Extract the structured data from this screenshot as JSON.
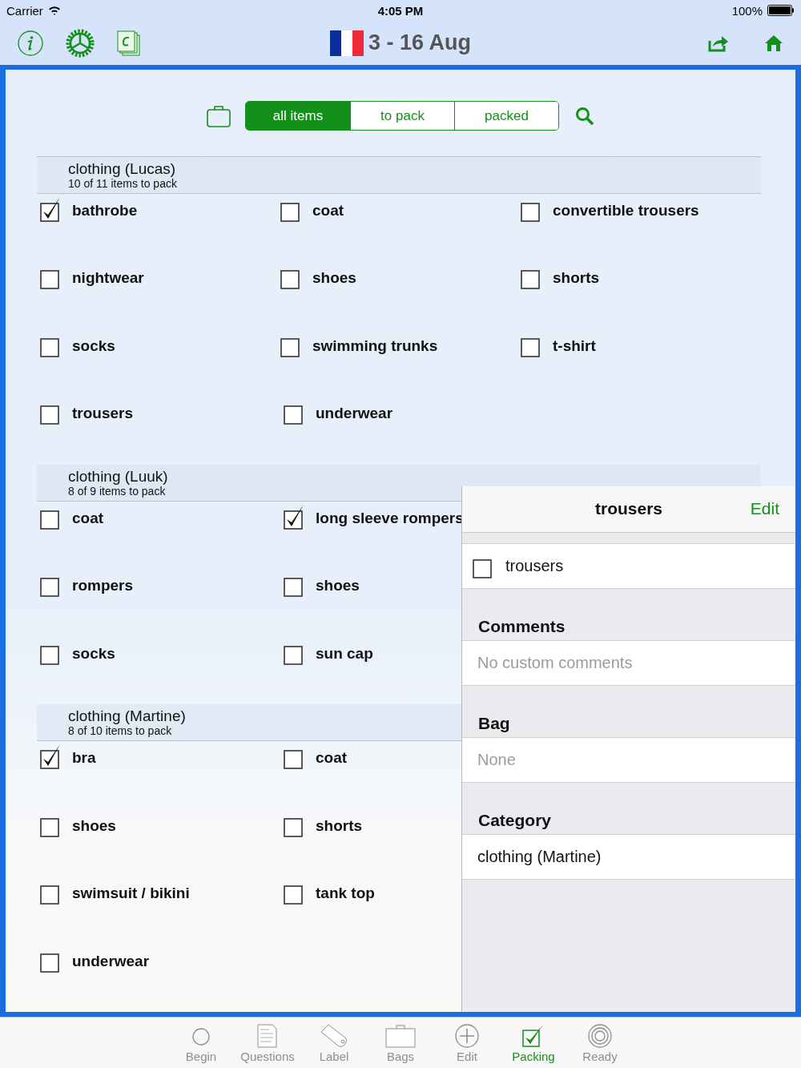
{
  "status_bar": {
    "carrier": "Carrier",
    "time": "4:05 PM",
    "battery": "100%"
  },
  "nav": {
    "title": "3 - 16 Aug"
  },
  "filter": {
    "segments": [
      {
        "label": "all items",
        "selected": true
      },
      {
        "label": "to pack",
        "selected": false
      },
      {
        "label": "packed",
        "selected": false
      }
    ]
  },
  "sections": [
    {
      "title": "clothing (Lucas)",
      "subtitle": "10 of 11 items to pack",
      "rows": [
        [
          {
            "label": "bathrobe",
            "checked": true
          },
          {
            "label": "coat",
            "checked": false
          },
          {
            "label": "convertible trousers",
            "checked": false
          }
        ],
        [
          {
            "label": "nightwear",
            "checked": false
          },
          {
            "label": "shoes",
            "checked": false
          },
          {
            "label": "shorts",
            "checked": false
          }
        ],
        [
          {
            "label": "socks",
            "checked": false
          },
          {
            "label": "swimming trunks",
            "checked": false
          },
          {
            "label": "t-shirt",
            "checked": false
          }
        ],
        [
          {
            "label": "trousers",
            "checked": false
          },
          {
            "label": "underwear",
            "checked": false
          }
        ]
      ]
    },
    {
      "title": "clothing (Luuk)",
      "subtitle": "8 of 9 items to pack",
      "rows": [
        [
          {
            "label": "coat",
            "checked": false
          },
          {
            "label": "long sleeve rompers",
            "checked": true
          }
        ],
        [
          {
            "label": "rompers",
            "checked": false
          },
          {
            "label": "shoes",
            "checked": false
          }
        ],
        [
          {
            "label": "socks",
            "checked": false
          },
          {
            "label": "sun cap",
            "checked": false
          }
        ]
      ]
    },
    {
      "title": "clothing (Martine)",
      "subtitle": "8 of 10 items to pack",
      "rows": [
        [
          {
            "label": "bra",
            "checked": true
          },
          {
            "label": "coat",
            "checked": false
          }
        ],
        [
          {
            "label": "shoes",
            "checked": false
          },
          {
            "label": "shorts",
            "checked": false
          }
        ],
        [
          {
            "label": "swimsuit / bikini",
            "checked": false
          },
          {
            "label": "tank top",
            "checked": false
          }
        ],
        [
          {
            "label": "underwear",
            "checked": false
          }
        ]
      ]
    }
  ],
  "detail": {
    "title": "trousers",
    "edit": "Edit",
    "item": {
      "label": "trousers",
      "checked": false
    },
    "groups": [
      {
        "heading": "Comments",
        "value": "No custom comments",
        "kind": "placeholder"
      },
      {
        "heading": "Bag",
        "value": "None",
        "kind": "placeholder"
      },
      {
        "heading": "Category",
        "value": "clothing (Martine)",
        "kind": "value"
      }
    ]
  },
  "tab_bar": [
    {
      "label": "Begin",
      "selected": false
    },
    {
      "label": "Questions",
      "selected": false
    },
    {
      "label": "Label",
      "selected": false
    },
    {
      "label": "Bags",
      "selected": false
    },
    {
      "label": "Edit",
      "selected": false
    },
    {
      "label": "Packing",
      "selected": true
    },
    {
      "label": "Ready",
      "selected": false
    }
  ]
}
